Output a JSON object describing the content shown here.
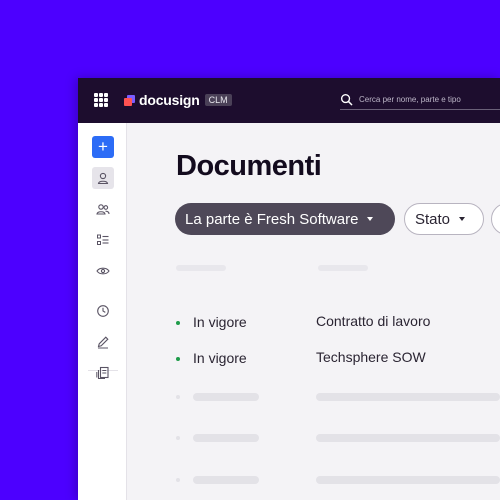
{
  "header": {
    "brand": "docusign",
    "badge": "CLM",
    "search_placeholder": "Cerca per nome, parte e tipo"
  },
  "sidebar": {
    "items": [
      {
        "icon": "plus-icon"
      },
      {
        "icon": "user-icon"
      },
      {
        "icon": "users-icon"
      },
      {
        "icon": "list-icon"
      },
      {
        "icon": "eye-icon"
      },
      {
        "icon": "clock-icon"
      },
      {
        "icon": "pen-icon"
      },
      {
        "icon": "documents-icon"
      }
    ]
  },
  "main": {
    "title": "Documenti",
    "filters": [
      {
        "label": "La parte è Fresh Software"
      },
      {
        "label": "Stato"
      }
    ],
    "rows": [
      {
        "status": "In vigore",
        "name": "Contratto di lavoro"
      },
      {
        "status": "In vigore",
        "name": "Techsphere SOW"
      }
    ]
  },
  "colors": {
    "background": "#4c00ff",
    "topbar": "#1d0d2e",
    "accent": "#2c6cf6",
    "status_active": "#1e9b4a"
  }
}
